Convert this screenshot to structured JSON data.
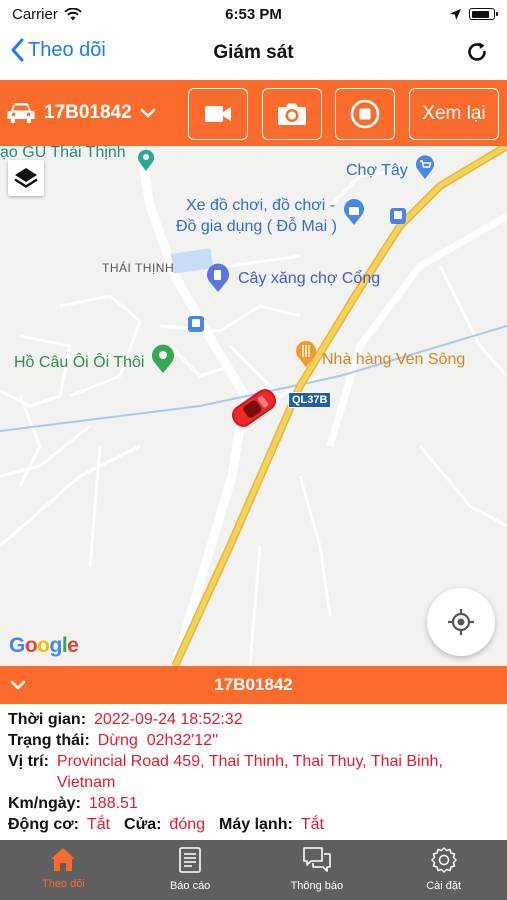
{
  "status_bar": {
    "carrier": "Carrier",
    "time": "6:53 PM",
    "battery_level": 0.85
  },
  "nav": {
    "back_label": "Theo dõi",
    "title": "Giám sát"
  },
  "toolbar": {
    "vehicle_plate": "17B01842",
    "replay_label": "Xem lại"
  },
  "map": {
    "labels": {
      "thai_thinh_top": "ạo GU Thái Thịnh",
      "cho_tay": "Chợ Tây",
      "shop_line1": "Xe đồ chơi, đồ chơi -",
      "shop_line2": "Đồ gia dụng ( Đỗ Mai )",
      "thai_thinh": "THÁI THỊNH",
      "gas_station": "Cây xăng chợ Cổng",
      "restaurant": "Nhà hàng Ven Sông",
      "fishing": "Hồ Câu Ôi Ôi Thôi",
      "road_badge": "QL37B"
    },
    "google_logo": "Google",
    "colors": {
      "highway": "#f6c945",
      "river": "#a8c8f0",
      "accent": "#fb6c2c"
    }
  },
  "info": {
    "plate": "17B01842",
    "time_label": "Thời gian:",
    "time_value": "2022-09-24 18:52:32",
    "status_label": "Trạng thái:",
    "status_value": "Dừng  02h32'12''",
    "location_label": "Vị trí:",
    "location_value": "Provincial Road 459, Thai Thinh, Thai Thuy, Thai Binh, Vietnam",
    "km_label": "Km/ngày:",
    "km_value": "188.51",
    "engine_label": "Động cơ:",
    "engine_value": "Tắt",
    "door_label": "Cửa:",
    "door_value": "đóng",
    "ac_label": "Máy lạnh:",
    "ac_value": "Tắt"
  },
  "tabs": [
    {
      "label": "Theo dõi",
      "icon": "home-icon",
      "active": true
    },
    {
      "label": "Báo cáo",
      "icon": "report-icon",
      "active": false
    },
    {
      "label": "Thông báo",
      "icon": "chat-icon",
      "active": false
    },
    {
      "label": "Cài đặt",
      "icon": "gear-icon",
      "active": false
    }
  ]
}
